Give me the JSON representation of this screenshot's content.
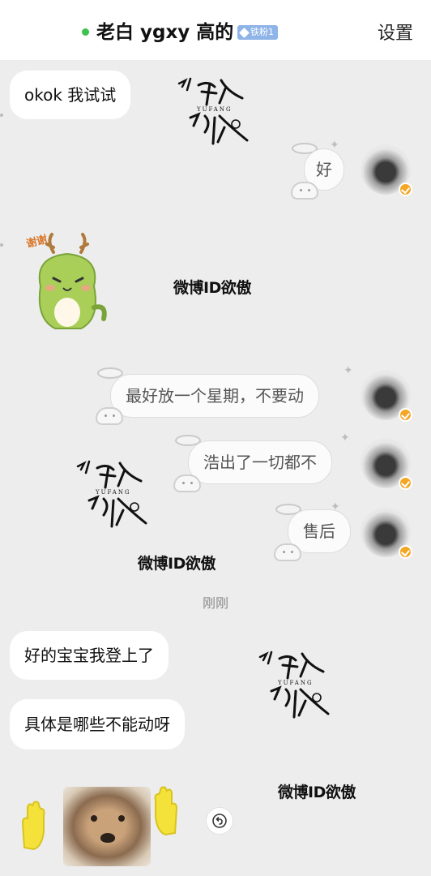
{
  "header": {
    "title": "老白 ygxy 高的",
    "fan_badge": "铁粉1",
    "settings_label": "设置",
    "online_color": "#3bc24f"
  },
  "messages": [
    {
      "side": "left",
      "text": "okok 我试试"
    },
    {
      "side": "right",
      "text": "好"
    },
    {
      "side": "right",
      "text": "最好放一个星期，不要动"
    },
    {
      "side": "right",
      "text": "浩出了一切都不"
    },
    {
      "side": "right",
      "text": "售后"
    },
    {
      "side": "left",
      "text": "好的宝宝我登上了"
    },
    {
      "side": "left",
      "text": "具体是哪些不能动呀"
    }
  ],
  "timestamp": "刚刚",
  "stickers": {
    "dragon_caption": "谢谢"
  },
  "watermark": {
    "text": "微博ID欲傲",
    "logo_text": "欲傲"
  },
  "icons": {
    "undo": "undo-icon",
    "verified": "verified-badge-icon",
    "fan_gem": "diamond-icon"
  }
}
